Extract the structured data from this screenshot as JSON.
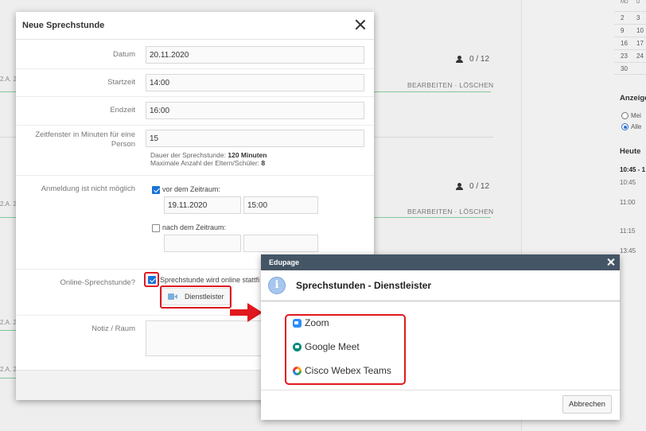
{
  "background": {
    "appointments": [
      {
        "count": "0 / 12",
        "actions": "BEARBEITEN · LÖSCHEN"
      },
      {
        "count": "0 / 12",
        "actions": "BEARBEITEN · LÖSCHEN"
      }
    ],
    "left_labels": [
      "2.A. 2",
      "2.A. 2",
      "2.A. 2",
      "2.A. 2"
    ],
    "calendar": {
      "header": [
        "MO",
        "D"
      ],
      "rows": [
        [
          "2",
          "3"
        ],
        [
          "9",
          "10"
        ],
        [
          "16",
          "17"
        ],
        [
          "23",
          "24"
        ],
        [
          "30",
          ""
        ]
      ]
    },
    "sidebar": {
      "show_label": "Anzeige",
      "radio_options": [
        {
          "label": "Mei",
          "selected": false
        },
        {
          "label": "Alle",
          "selected": true
        }
      ],
      "today_label": "Heute",
      "today_range": "10:45 - 1",
      "times": [
        "10:45",
        "11:00",
        "11:15",
        "13:45"
      ]
    }
  },
  "dialog": {
    "title": "Neue Sprechstunde",
    "fields": {
      "datum": {
        "label": "Datum",
        "value": "20.11.2020"
      },
      "startzeit": {
        "label": "Startzeit",
        "value": "14:00"
      },
      "endzeit": {
        "label": "Endzeit",
        "value": "16:00"
      },
      "zeitfenster": {
        "label": "Zeitfenster in Minuten für eine Person",
        "value": "15"
      }
    },
    "hint_duration_label": "Dauer der Sprechstunde:",
    "hint_duration_value": "120 Minuten",
    "hint_max_label": "Maximale Anzahl der Eltern/Schüler:",
    "hint_max_value": "8",
    "registration": {
      "label": "Anmeldung ist nicht möglich",
      "before": {
        "label": "vor dem Zeitraum:",
        "checked": true,
        "date": "19.11.2020",
        "time": "15:00"
      },
      "after": {
        "label": "nach dem Zeitraum:",
        "checked": false,
        "date": "",
        "time": ""
      }
    },
    "online": {
      "label": "Online-Sprechstunde?",
      "checkbox_label": "Sprechstunde wird online stattfi",
      "checked": true,
      "provider_button": "Dienstleister"
    },
    "note": {
      "label": "Notiz / Raum",
      "value": ""
    }
  },
  "popup": {
    "titlebar": "Edupage",
    "heading": "Sprechstunden - Dienstleister",
    "info_icon": "i",
    "services": [
      {
        "name": "Zoom",
        "icon": "zoom-icon"
      },
      {
        "name": "Google Meet",
        "icon": "google-meet-icon"
      },
      {
        "name": "Cisco Webex Teams",
        "icon": "webex-icon"
      }
    ],
    "cancel_button": "Abbrechen"
  },
  "colors": {
    "highlight_red": "#e0191f",
    "popup_titlebar": "#445566",
    "checkbox_blue": "#1a73d9",
    "accent_green": "#7fc99a"
  }
}
